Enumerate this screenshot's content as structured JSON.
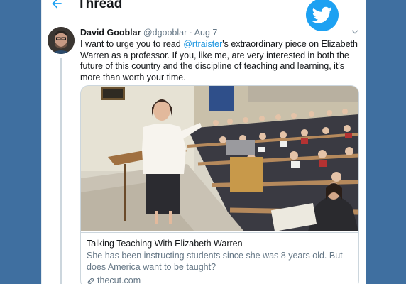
{
  "header": {
    "title": "Thread",
    "back_icon": "arrow-left-icon"
  },
  "brand": {
    "icon": "twitter-bird-icon",
    "color": "#1da1f2"
  },
  "tweet": {
    "author_name": "David Gooblar",
    "handle": "@dgooblar",
    "separator": " · ",
    "date": "Aug 7",
    "text_before": "I want to urge you to read ",
    "mention": "@rtraister",
    "text_after": "'s extraordinary piece on Elizabeth Warren as a professor. If you, like me, are very interested in both the future of this country and the discipline of teaching and learning, it's more than worth your time."
  },
  "link_card": {
    "title": "Talking Teaching With Elizabeth Warren",
    "description": "She has been instructing students since she was 8 years old. But does America want to be taught?",
    "domain": "thecut.com",
    "domain_icon": "link-icon"
  },
  "colors": {
    "accent": "#1da1f2",
    "mention": "#1b95e0",
    "secondary_text": "#657786",
    "border": "#ccd6dd",
    "page_background": "#3f6fa0"
  }
}
